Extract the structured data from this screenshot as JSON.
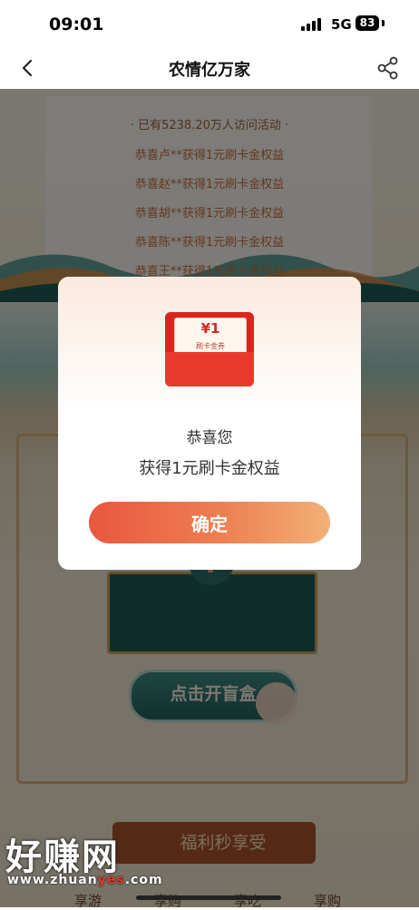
{
  "status_bar": {
    "time": "09:01",
    "network": "5G",
    "battery": "83"
  },
  "nav": {
    "title": "农情亿万家",
    "back_icon": "chevron-left-icon",
    "share_icon": "share-icon"
  },
  "background": {
    "visits_text": "· 已有5238.20万人访问活动 ·",
    "winners": [
      "恭喜卢**获得1元刷卡金权益",
      "恭喜赵**获得1元刷卡金权益",
      "恭喜胡**获得1元刷卡金权益",
      "恭喜陈**获得1元刷卡金权益",
      "恭喜王**获得1元刷卡金权益"
    ],
    "open_box_button": "点击开盲盒",
    "promo_text": "福利秒享受",
    "tabs": [
      "享游",
      "享购",
      "享吃",
      "享购"
    ]
  },
  "dialog": {
    "envelope_amount": "¥1",
    "envelope_label": "刷卡金券",
    "heading": "恭喜您",
    "message": "获得1元刷卡金权益",
    "confirm_label": "确定"
  },
  "watermark": {
    "text": "好赚网",
    "url_prefix": "www.zhuan",
    "url_highlight": "yes",
    "url_suffix": ".com"
  },
  "colors": {
    "confirm_start": "#e9573f",
    "confirm_end": "#f2b176",
    "envelope_red": "#d8261e"
  }
}
